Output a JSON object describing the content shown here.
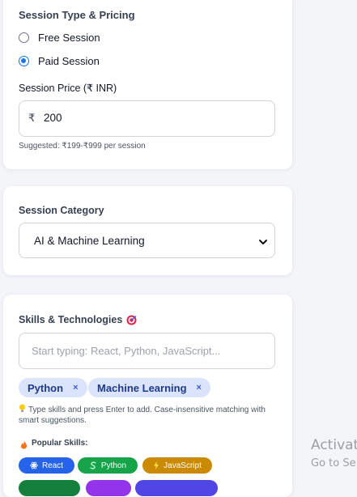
{
  "pricing": {
    "title": "Session Type & Pricing",
    "options": [
      {
        "label": "Free Session",
        "selected": false
      },
      {
        "label": "Paid Session",
        "selected": true
      }
    ],
    "price_label": "Session Price (₹ INR)",
    "currency_symbol": "₹",
    "price_value": "200",
    "suggestion": "Suggested: ₹199-₹999 per session"
  },
  "category": {
    "title": "Session Category",
    "selected": "AI & Machine Learning"
  },
  "skills": {
    "title": "Skills & Technologies",
    "title_icon": "target-emoji",
    "input_placeholder": "Start typing: React, Python, JavaScript...",
    "selected_tags": [
      "Python",
      "Machine Learning"
    ],
    "remove_glyph": "×",
    "tip_icon": "lightbulb-emoji",
    "tip": "Type skills and press Enter to add. Case-insensitive matching with smart suggestions.",
    "popular_icon": "fire-emoji",
    "popular_label": "Popular Skills:",
    "popular": [
      {
        "label": "React",
        "icon": "atom-icon",
        "color": "#2563eb"
      },
      {
        "label": "Python",
        "icon": "snake-icon",
        "color": "#16a34a"
      },
      {
        "label": "JavaScript",
        "icon": "bolt-icon",
        "color": "#ca8a04"
      }
    ],
    "popular_partial_colors": [
      "#15803d",
      "#9333ea",
      "#4f46e5"
    ]
  },
  "watermark": {
    "line1": "Activat",
    "line2": "Go to Se"
  },
  "colors": {
    "accent": "#1a73e8",
    "chip_bg": "#dbe4fb",
    "chip_text": "#1e3a8a"
  }
}
